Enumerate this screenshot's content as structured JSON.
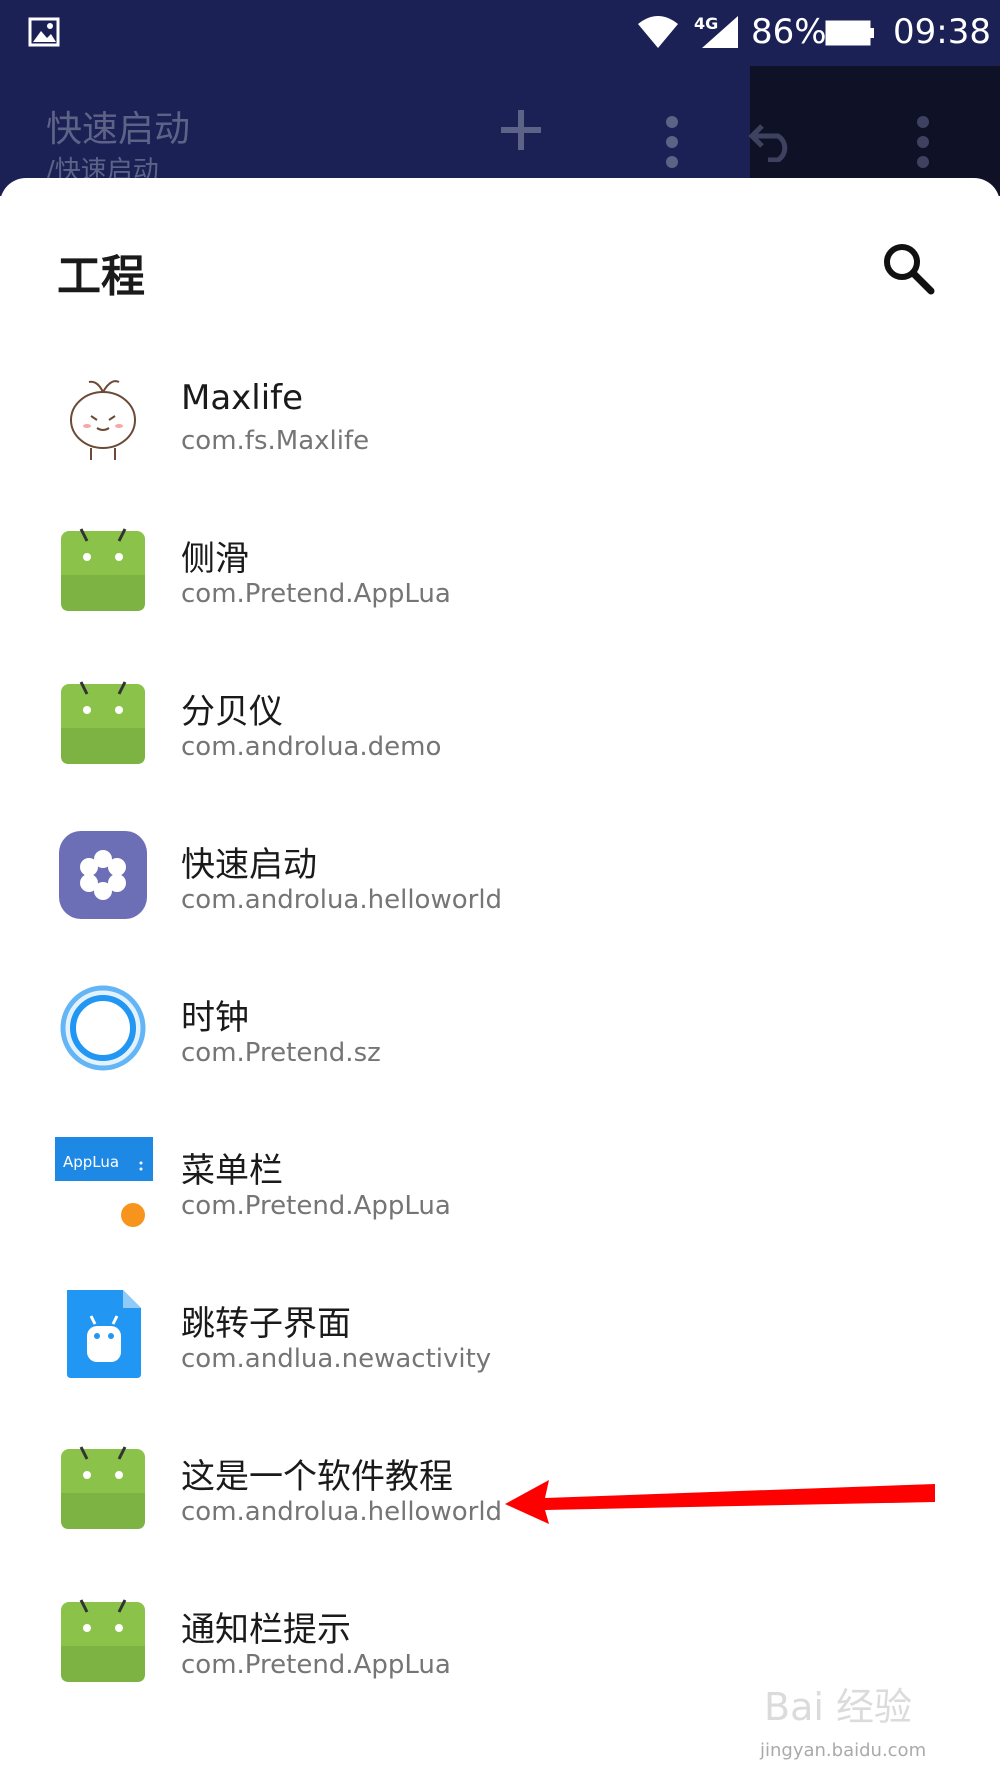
{
  "status_bar": {
    "network": "4G",
    "battery_percent": "86%",
    "time": "09:38",
    "icons": [
      "gallery-icon",
      "wifi-icon",
      "signal-icon",
      "battery-icon"
    ]
  },
  "app_bar": {
    "title": "快速启动",
    "subtitle": "/快速启动",
    "icons": [
      "add-icon",
      "more-vert-icon",
      "undo-icon",
      "more-vert-icon"
    ]
  },
  "sheet": {
    "title": "工程",
    "search_icon": "search-icon",
    "items": [
      {
        "name": "Maxlife",
        "package": "com.fs.Maxlife",
        "icon": "sprout-character-icon"
      },
      {
        "name": "侧滑",
        "package": "com.Pretend.AppLua",
        "icon": "android-icon"
      },
      {
        "name": "分贝仪",
        "package": "com.androlua.demo",
        "icon": "android-icon"
      },
      {
        "name": "快速启动",
        "package": "com.androlua.helloworld",
        "icon": "flower-gear-icon"
      },
      {
        "name": "时钟",
        "package": "com.Pretend.sz",
        "icon": "blue-ring-icon"
      },
      {
        "name": "菜单栏",
        "package": "com.Pretend.AppLua",
        "icon": "applua-toolbar-icon",
        "icon_label": "AppLua"
      },
      {
        "name": "跳转子界面",
        "package": "com.andlua.newactivity",
        "icon": "android-file-icon"
      },
      {
        "name": "这是一个软件教程",
        "package": "com.androlua.helloworld",
        "icon": "android-icon"
      },
      {
        "name": "通知栏提示",
        "package": "com.Pretend.AppLua",
        "icon": "android-icon"
      }
    ]
  },
  "annotation": {
    "icon": "red-arrow-pointing-left"
  },
  "watermark": {
    "text": "jingyan.baidu.com",
    "logo": "Bai 经验"
  },
  "colors": {
    "status_bar": "#1b2155",
    "android_green": "#8bc34a",
    "arrow_red": "#ff0000",
    "package_gray": "#757575"
  }
}
